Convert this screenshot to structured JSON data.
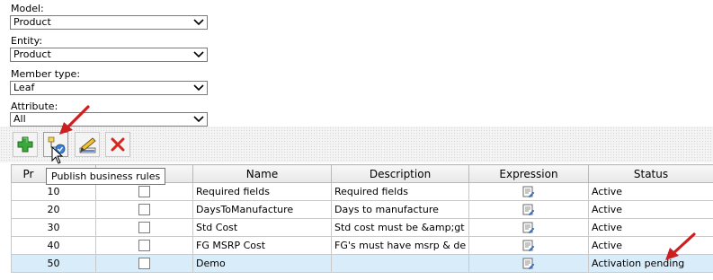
{
  "filters": {
    "model": {
      "label": "Model:",
      "value": "Product"
    },
    "entity": {
      "label": "Entity:",
      "value": "Product"
    },
    "member_type": {
      "label": "Member type:",
      "value": "Leaf"
    },
    "attribute": {
      "label": "Attribute:",
      "value": "All"
    }
  },
  "toolbar": {
    "buttons": [
      {
        "name": "add",
        "icon": "green-plus-icon"
      },
      {
        "name": "publish",
        "icon": "publish-rules-icon"
      },
      {
        "name": "edit",
        "icon": "edit-pencil-icon"
      },
      {
        "name": "delete",
        "icon": "red-x-icon"
      }
    ],
    "tooltip": "Publish business rules"
  },
  "grid": {
    "columns": [
      "Pr",
      "ed",
      "Name",
      "Description",
      "Expression",
      "Status"
    ],
    "rows": [
      {
        "priority": "10",
        "name": "Required fields",
        "description": "Required fields",
        "status": "Active"
      },
      {
        "priority": "20",
        "name": "DaysToManufacture",
        "description": "Days to manufacture",
        "status": "Active"
      },
      {
        "priority": "30",
        "name": "Std Cost",
        "description": "Std cost must be &amp;gt",
        "status": "Active"
      },
      {
        "priority": "40",
        "name": "FG MSRP Cost",
        "description": "FG's must have msrp & de",
        "status": "Active"
      },
      {
        "priority": "50",
        "name": "Demo",
        "description": "",
        "status": "Activation pending"
      }
    ]
  },
  "colors": {
    "annotation_arrow": "#cc1f1f",
    "selected_row": "#d9ecf9"
  }
}
